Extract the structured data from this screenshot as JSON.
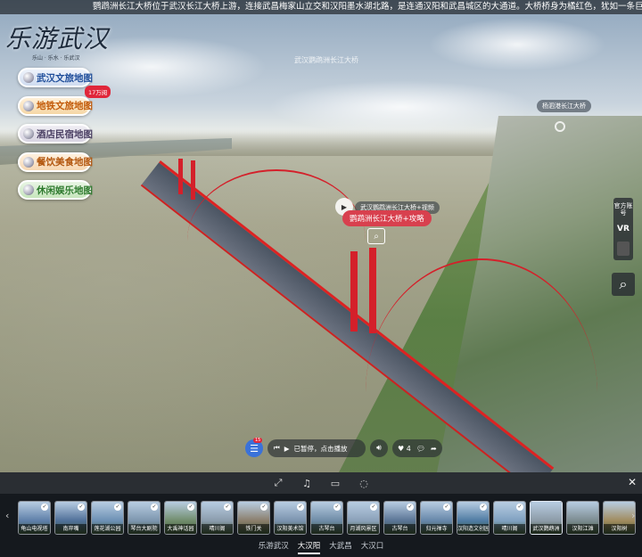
{
  "marquee": "鹦鹉洲长江大桥位于武汉长江大桥上游，连接武昌梅家山立交和汉阳墨水湖北路，是连通汉阳和武昌城区的大通道。大桥桥身为橘红色，犹如一条巨龙横卧在长江之上，颇为壮观。鹦鹉洲长江大桥",
  "logo": {
    "title": "乐游武汉",
    "subtitle": "乐山 · 乐水 · 乐武汉"
  },
  "scene_watermark": "武汉鹦鹉洲长江大桥",
  "menu": [
    {
      "label": "武汉文旅地图"
    },
    {
      "label": "地铁文旅地图"
    },
    {
      "label": "酒店民宿地图"
    },
    {
      "label": "餐饮美食地图"
    },
    {
      "label": "休闲娱乐地图"
    }
  ],
  "menu_badge": "17万阅",
  "hotspots": {
    "top_right_label": "杨泗港长江大桥",
    "video_label": "武汉鹦鹉洲长江大桥+视频",
    "guide_label": "鹦鹉洲长江大桥+攻略",
    "play_icon": "▶",
    "search_icon": "⌕"
  },
  "right_toolbar": {
    "official": "官方账号",
    "vr": "VR",
    "avatar": "头像",
    "search": "⌕"
  },
  "controls": {
    "menu_badge": "15",
    "player_text": "已暂停，点击播放",
    "like_count": "4",
    "comment": "评论",
    "share": "分享"
  },
  "toolbar_icons": [
    "expand-icon",
    "music-icon",
    "vr-glasses-icon",
    "gyro-icon"
  ],
  "thumbnails": [
    {
      "caption": "龟山电视塔",
      "checked": true,
      "color": "#5d7ea8"
    },
    {
      "caption": "南岸嘴",
      "checked": true,
      "color": "#4f6f98"
    },
    {
      "caption": "莲花湖公园",
      "checked": true,
      "color": "#6b8fb3"
    },
    {
      "caption": "琴台大剧院",
      "checked": true,
      "color": "#7c95ad"
    },
    {
      "caption": "大禹神话园",
      "checked": true,
      "color": "#6f8b6a"
    },
    {
      "caption": "晴川阁",
      "checked": true,
      "color": "#8a9bab"
    },
    {
      "caption": "铁门关",
      "checked": true,
      "color": "#8a7d6a"
    },
    {
      "caption": "汉阳美术馆",
      "checked": true,
      "color": "#7a92ad"
    },
    {
      "caption": "古琴台",
      "checked": true,
      "color": "#6d8aa5"
    },
    {
      "caption": "月湖风景区",
      "checked": true,
      "color": "#8aa0b8"
    },
    {
      "caption": "古琴台",
      "checked": true,
      "color": "#597394"
    },
    {
      "caption": "归元禅寺",
      "checked": true,
      "color": "#6585a8"
    },
    {
      "caption": "汉阳造文创园",
      "checked": true,
      "color": "#4e7aa2"
    },
    {
      "caption": "晴川阁",
      "checked": true,
      "color": "#7fa0c0"
    },
    {
      "caption": "武汉鹦鹉洲",
      "checked": false,
      "color": "#8c9aa6"
    },
    {
      "caption": "汉阳江滩",
      "checked": false,
      "color": "#7b8a8f"
    },
    {
      "caption": "汉阳树",
      "checked": false,
      "color": "#a08a5c"
    }
  ],
  "categories": [
    {
      "label": "乐游武汉",
      "active": false
    },
    {
      "label": "大汉阳",
      "active": true
    },
    {
      "label": "大武昌",
      "active": false
    },
    {
      "label": "大汉口",
      "active": false
    }
  ],
  "colors": {
    "accent": "#3a72d9",
    "bridge": "#d4202a",
    "panel": "#15191e"
  }
}
